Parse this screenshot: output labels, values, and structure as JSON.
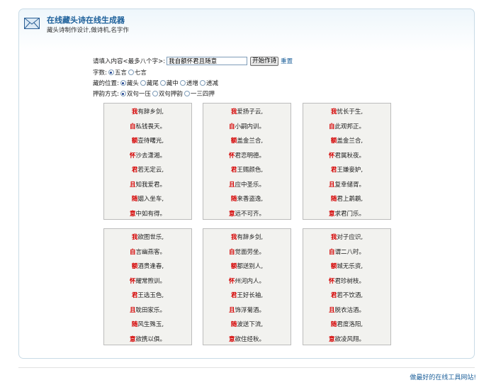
{
  "header": {
    "title": "在线藏头诗在线生成器",
    "subtitle": "藏头诗制作设计,做诗机,名字作"
  },
  "form": {
    "input_label": "请填入内容<最多八个字>:",
    "input_value": "我自额怀君且随意",
    "submit_label": "开始作诗",
    "reset_label": "重置",
    "char_count_label": "字数:",
    "char_count_options": [
      "五言",
      "七言"
    ],
    "char_count_selected": "五言",
    "position_label": "藏的位置:",
    "position_options": [
      "藏头",
      "藏尾",
      "藏中",
      "递增",
      "递减"
    ],
    "position_selected": "藏头",
    "rhyme_label": "押韵方式:",
    "rhyme_options": [
      "双句一压",
      "双句押韵",
      "一三四押"
    ],
    "rhyme_selected": "双句一压"
  },
  "poems": [
    {
      "lines": [
        {
          "head": "我",
          "rest": "有辞乡剑,"
        },
        {
          "head": "自",
          "rest": "私钱畏天。"
        },
        {
          "head": "额",
          "rest": "壶待曙光,"
        },
        {
          "head": "怀",
          "rest": "沙去潇湘。"
        },
        {
          "head": "君",
          "rest": "若无定云,"
        },
        {
          "head": "且",
          "rest": "知我爱君。"
        },
        {
          "head": "随",
          "rest": "姻入坐车,"
        },
        {
          "head": "意",
          "rest": "中如有得。"
        }
      ]
    },
    {
      "lines": [
        {
          "head": "我",
          "rest": "爱扬子云,"
        },
        {
          "head": "自",
          "rest": "小嗣内训。"
        },
        {
          "head": "额",
          "rest": "盖金兰合,"
        },
        {
          "head": "怀",
          "rest": "君恋明德。"
        },
        {
          "head": "君",
          "rest": "王赐颜色,"
        },
        {
          "head": "且",
          "rest": "应中圣乐。"
        },
        {
          "head": "随",
          "rest": "来香盗逸,"
        },
        {
          "head": "意",
          "rest": "远不可齐。"
        }
      ]
    },
    {
      "lines": [
        {
          "head": "我",
          "rest": "忧长于生,"
        },
        {
          "head": "自",
          "rest": "此观邦正。"
        },
        {
          "head": "额",
          "rest": "盖金兰合,"
        },
        {
          "head": "怀",
          "rest": "君属秋夜。"
        },
        {
          "head": "君",
          "rest": "王嫌妾妒,"
        },
        {
          "head": "且",
          "rest": "复幸储胥。"
        },
        {
          "head": "随",
          "rest": "君上鹔鹴,"
        },
        {
          "head": "意",
          "rest": "求君门乐。"
        }
      ]
    },
    {
      "lines": [
        {
          "head": "我",
          "rest": "欲图世乐,"
        },
        {
          "head": "自",
          "rest": "言幽燕客。"
        },
        {
          "head": "额",
          "rest": "酒贵逢春,"
        },
        {
          "head": "怀",
          "rest": "耀常煦训。"
        },
        {
          "head": "君",
          "rest": "王选玉色,"
        },
        {
          "head": "且",
          "rest": "耽田家乐。"
        },
        {
          "head": "随",
          "rest": "风生殊玉,"
        },
        {
          "head": "意",
          "rest": "欲携以俱。"
        }
      ]
    },
    {
      "lines": [
        {
          "head": "我",
          "rest": "有辞乡剑,"
        },
        {
          "head": "自",
          "rest": "觉面劳坐。"
        },
        {
          "head": "额",
          "rest": "都送别人,"
        },
        {
          "head": "怀",
          "rest": "州河内人。"
        },
        {
          "head": "君",
          "rest": "王好长袖,"
        },
        {
          "head": "且",
          "rest": "饰浮菊酒。"
        },
        {
          "head": "随",
          "rest": "波送下流,"
        },
        {
          "head": "意",
          "rest": "欲住经秋。"
        }
      ]
    },
    {
      "lines": [
        {
          "head": "我",
          "rest": "对子应识,"
        },
        {
          "head": "自",
          "rest": "谓二八时。"
        },
        {
          "head": "额",
          "rest": "城无乐资,"
        },
        {
          "head": "怀",
          "rest": "君珍树枝。"
        },
        {
          "head": "君",
          "rest": "若不饮酒,"
        },
        {
          "head": "且",
          "rest": "脱衣沽酒。"
        },
        {
          "head": "随",
          "rest": "君度洛阳,"
        },
        {
          "head": "意",
          "rest": "欲凌风翔。"
        }
      ]
    }
  ],
  "footer": {
    "link_text": "做最好的在线工具网站!"
  }
}
